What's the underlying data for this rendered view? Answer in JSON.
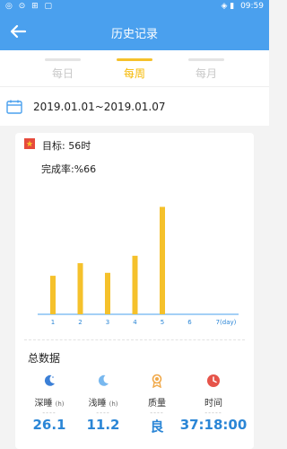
{
  "status": {
    "left_icons": "◎ ⊙ ⊞ ▢",
    "right_icons": "◈ ▮",
    "time": "09:59"
  },
  "header": {
    "title": "历史记录",
    "back_icon": "arrow-left-icon"
  },
  "tabs": [
    {
      "label": "每日",
      "active": false
    },
    {
      "label": "每周",
      "active": true
    },
    {
      "label": "每月",
      "active": false
    }
  ],
  "date_range": "2019.01.01~2019.01.07",
  "goal": {
    "text": "目标: 56时"
  },
  "completion": {
    "text": "完成率:%66"
  },
  "chart_data": {
    "type": "bar",
    "categories": [
      "1",
      "2",
      "3",
      "4",
      "5",
      "6",
      "7(day)"
    ],
    "values": [
      5.2,
      6.9,
      5.6,
      7.9,
      14.5,
      0,
      0
    ],
    "ylim": [
      0,
      16
    ],
    "bar_color": "#f5c12b",
    "axis_color": "#4aa0ee"
  },
  "summary": {
    "title": "总数据",
    "stats": [
      {
        "label": "深睡",
        "unit": "(h)",
        "dash": "----",
        "value": "26.1",
        "icon": "moon-icon",
        "color": "#3b7fd6"
      },
      {
        "label": "浅睡",
        "unit": "(h)",
        "dash": "----",
        "value": "11.2",
        "icon": "moon-icon",
        "color": "#78b8ef"
      },
      {
        "label": "质量",
        "unit": "",
        "dash": "----",
        "value": "良",
        "icon": "medal-icon",
        "color": "#f0a848"
      },
      {
        "label": "时间",
        "unit": "",
        "dash": "-----",
        "value": "37:18:00",
        "icon": "clock-icon",
        "color": "#e6544a"
      }
    ]
  },
  "colors": {
    "primary": "#4aa0ee",
    "accent": "#f5c12b",
    "value": "#2b86d6"
  }
}
